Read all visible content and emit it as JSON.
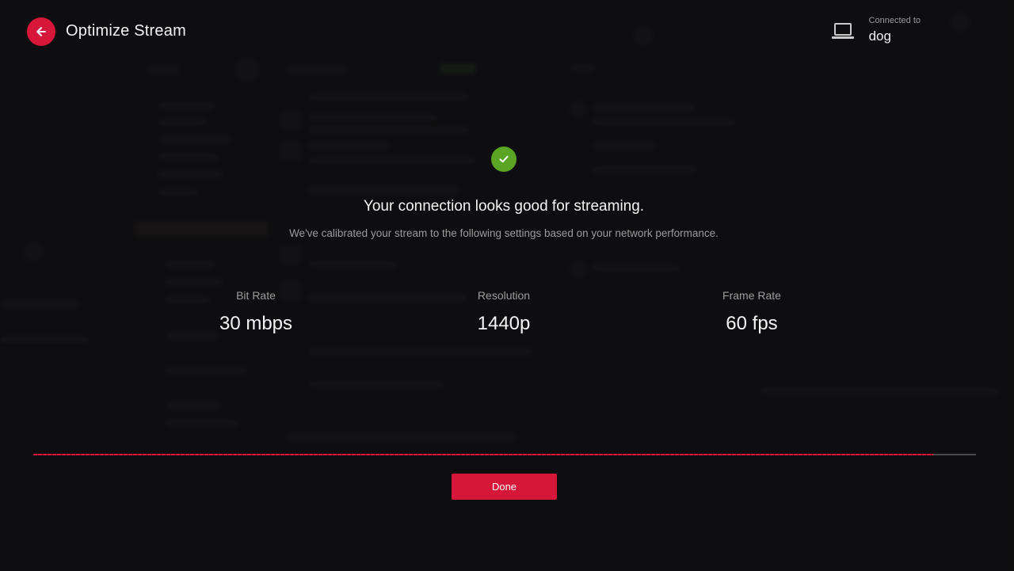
{
  "header": {
    "title": "Optimize Stream",
    "connected_label": "Connected to",
    "device_name": "dog"
  },
  "result": {
    "headline": "Your connection looks good for streaming.",
    "subline": "We've calibrated your stream to the following settings based on your network performance."
  },
  "stats": [
    {
      "label": "Bit Rate",
      "value": "30 mbps"
    },
    {
      "label": "Resolution",
      "value": "1440p"
    },
    {
      "label": "Frame Rate",
      "value": "60 fps"
    }
  ],
  "progress": {
    "fraction": 0.955
  },
  "footer": {
    "done_label": "Done"
  },
  "icons": {
    "back": "arrow-left-icon",
    "device": "laptop-icon",
    "status": "checkmark-icon"
  },
  "colors": {
    "accent": "#d6173a",
    "success": "#5aa524",
    "background": "#161617"
  }
}
